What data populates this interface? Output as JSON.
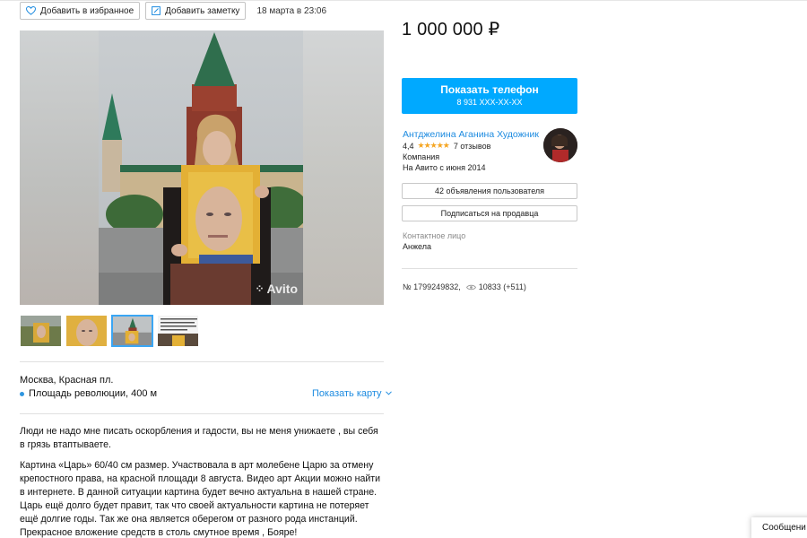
{
  "actions": {
    "favorite_label": "Добавить в избранное",
    "note_label": "Добавить заметку",
    "date": "18 марта в 23:06"
  },
  "gallery": {
    "watermark": "Avito"
  },
  "location": {
    "address": "Москва, Красная пл.",
    "metro": "Площадь революции, 400 м",
    "show_map": "Показать карту"
  },
  "description": {
    "p1": "Люди не надо мне писать оскорбления и гадости, вы не меня унижаете , вы себя в грязь втаптываете.",
    "p2": "Картина «Царь» 60/40 см размер. Участвовала в арт молебене Царю за отмену крепостного права, на красной площади 8 августа. Видео арт Акции можно найти в интернете. В данной ситуации картина будет вечно актуальна в нашей стране. Царь ещё долго будет правит, так что своей актуальности картина не потеряет ещё долгие годы. Так же она является оберегом от разного рода инстанций. Прекрасное вложение средств в столь смутное время , Бояре!"
  },
  "price": "1 000 000 ₽",
  "phone": {
    "label": "Показать телефон",
    "number": "8 931 XXX-XX-XX"
  },
  "seller": {
    "name": "Антджелина Аганина Художник",
    "rating": "4,4",
    "rating_value": 4.4,
    "reviews": "7 отзывов",
    "type": "Компания",
    "since": "На Авито с июня 2014"
  },
  "buttons": {
    "listings": "42 объявления пользователя",
    "subscribe": "Подписаться на продавца"
  },
  "contact": {
    "label": "Контактное лицо",
    "name": "Анжела"
  },
  "stats": {
    "id": "№ 1799249832,",
    "views": "10833 (+511)"
  },
  "messages_label": "Сообщени",
  "colors": {
    "accent": "#00a9ff",
    "link": "#1d8be0",
    "star": "#f5a623"
  }
}
